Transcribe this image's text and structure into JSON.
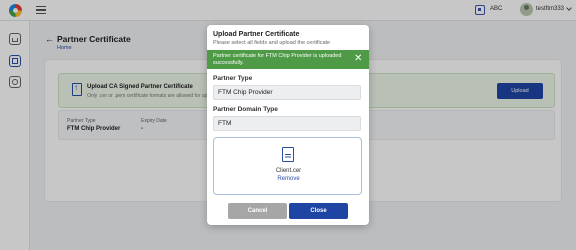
{
  "header": {
    "language": "ABC",
    "username": "testftm333"
  },
  "page": {
    "title": "Partner Certificate",
    "breadcrumb": "Home"
  },
  "upload_section": {
    "title": "Upload CA Signed Partner Certificate",
    "subtitle": "Only .cer or .pem certificate formats are allowed for uploa",
    "button_label": "Upload"
  },
  "cert_info": {
    "partner_type_label": "Partner Type",
    "partner_type_value": "FTM Chip Provider",
    "expiry_label": "Expiry Date",
    "expiry_value": "-"
  },
  "modal": {
    "title": "Upload Partner Certificate",
    "subtitle": "Please select all fields and upload the certificate",
    "alert_text": "Partner certificate for FTM Chip Provider is uploaded successfully.",
    "partner_type_label": "Partner Type",
    "partner_type_value": "FTM Chip Provider",
    "domain_type_label": "Partner Domain Type",
    "domain_type_value": "FTM",
    "file_name": "Client.cer",
    "remove_label": "Remove",
    "cancel_label": "Cancel",
    "close_label": "Close"
  },
  "colors": {
    "primary": "#1e45a4",
    "success": "#4f9a47",
    "cancel": "#a6a6a6"
  }
}
